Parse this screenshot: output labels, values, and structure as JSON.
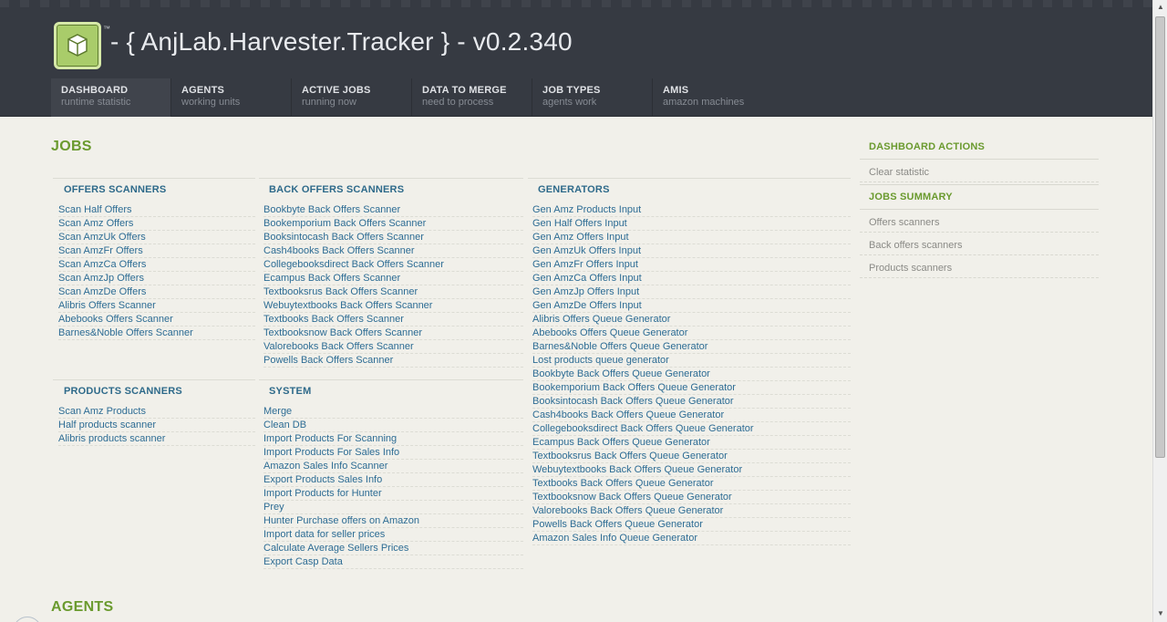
{
  "header": {
    "tm": "™",
    "title": "- { AnjLab.Harvester.Tracker } - v0.2.340",
    "nav": [
      {
        "label": "DASHBOARD",
        "sub": "runtime statistic"
      },
      {
        "label": "AGENTS",
        "sub": "working units"
      },
      {
        "label": "ACTIVE JOBS",
        "sub": "running now"
      },
      {
        "label": "DATA TO MERGE",
        "sub": "need to process"
      },
      {
        "label": "JOB TYPES",
        "sub": "agents work"
      },
      {
        "label": "AMIS",
        "sub": "amazon machines"
      }
    ]
  },
  "main": {
    "jobs_heading": "JOBS",
    "agents_heading": "AGENTS",
    "offers_scanners": {
      "title": "OFFERS SCANNERS",
      "items": [
        "Scan Half Offers",
        "Scan Amz Offers",
        "Scan AmzUk Offers",
        "Scan AmzFr Offers",
        "Scan AmzCa Offers",
        "Scan AmzJp Offers",
        "Scan AmzDe Offers",
        "Alibris Offers Scanner",
        "Abebooks Offers Scanner",
        "Barnes&Noble Offers Scanner"
      ]
    },
    "back_offers_scanners": {
      "title": "BACK OFFERS SCANNERS",
      "items": [
        "Bookbyte Back Offers Scanner",
        "Bookemporium Back Offers Scanner",
        "Booksintocash Back Offers Scanner",
        "Cash4books Back Offers Scanner",
        "Collegebooksdirect Back Offers Scanner",
        "Ecampus Back Offers Scanner",
        "Textbooksrus Back Offers Scanner",
        "Webuytextbooks Back Offers Scanner",
        "Textbooks Back Offers Scanner",
        "Textbooksnow Back Offers Scanner",
        "Valorebooks Back Offers Scanner",
        "Powells Back Offers Scanner"
      ]
    },
    "generators": {
      "title": "GENERATORS",
      "items": [
        "Gen Amz Products Input",
        "Gen Half Offers Input",
        "Gen Amz Offers Input",
        "Gen AmzUk Offers Input",
        "Gen AmzFr Offers Input",
        "Gen AmzCa Offers Input",
        "Gen AmzJp Offers Input",
        "Gen AmzDe Offers Input",
        "Alibris Offers Queue Generator",
        "Abebooks Offers Queue Generator",
        "Barnes&Noble Offers Queue Generator",
        "Lost products queue generator",
        "Bookbyte Back Offers Queue Generator",
        "Bookemporium Back Offers Queue Generator",
        "Booksintocash Back Offers Queue Generator",
        "Cash4books Back Offers Queue Generator",
        "Collegebooksdirect Back Offers Queue Generator",
        "Ecampus Back Offers Queue Generator",
        "Textbooksrus Back Offers Queue Generator",
        "Webuytextbooks Back Offers Queue Generator",
        "Textbooks Back Offers Queue Generator",
        "Textbooksnow Back Offers Queue Generator",
        "Valorebooks Back Offers Queue Generator",
        "Powells Back Offers Queue Generator",
        "Amazon Sales Info Queue Generator"
      ]
    },
    "products_scanners": {
      "title": "PRODUCTS SCANNERS",
      "items": [
        "Scan Amz Products",
        "Half products scanner",
        "Alibris products scanner"
      ]
    },
    "system": {
      "title": "SYSTEM",
      "items": [
        "Merge",
        "Clean DB",
        "Import Products For Scanning",
        "Import Products For Sales Info",
        "Amazon Sales Info Scanner",
        "Export Products Sales Info",
        "Import Products for Hunter",
        "Prey",
        "Hunter Purchase offers on Amazon",
        "Import data for seller prices",
        "Calculate Average Sellers Prices",
        "Export Casp Data"
      ]
    }
  },
  "sidebar": {
    "dashboard_actions": {
      "title": "DASHBOARD ACTIONS",
      "items": [
        "Clear statistic"
      ]
    },
    "jobs_summary": {
      "title": "JOBS SUMMARY",
      "items": [
        "Offers scanners",
        "Back offers scanners",
        "Products scanners"
      ]
    }
  },
  "colors": {
    "accent_green": "#6a9a2e",
    "link_blue": "#2d6c94",
    "header_bg": "#363a42"
  },
  "icons": {
    "logo": "box-icon"
  }
}
